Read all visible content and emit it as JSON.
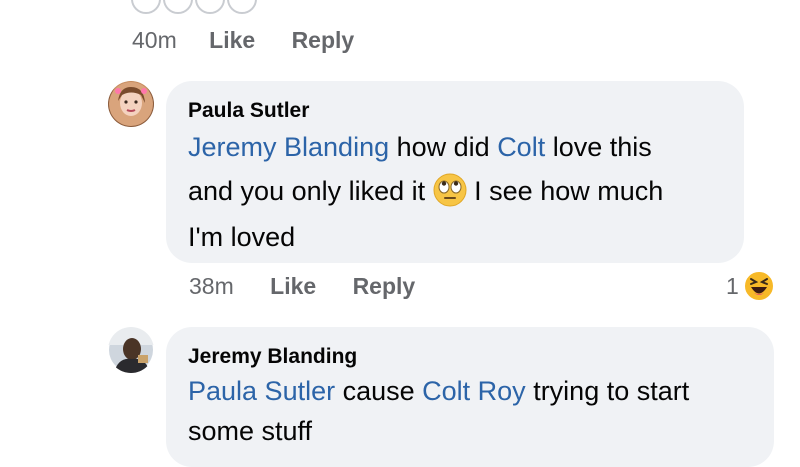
{
  "top_comment": {
    "time": "40m",
    "like_label": "Like",
    "reply_label": "Reply"
  },
  "comment1": {
    "author": "Paula Sutler",
    "mention1": "Jeremy Blanding",
    "text1": " how did ",
    "mention2": "Colt",
    "text2": " love this",
    "line2_before": "and you only liked it ",
    "emoji": "rolling-eyes-emoji",
    "line2_after": " I see how much",
    "line3": "I'm loved",
    "time": "38m",
    "like_label": "Like",
    "reply_label": "Reply",
    "reaction_count": "1",
    "reaction_icon": "haha-reaction-icon"
  },
  "comment2": {
    "author": "Jeremy Blanding",
    "mention1": "Paula Sutler",
    "text1": " cause ",
    "mention2": "Colt Roy",
    "text2": " trying to start",
    "line2": "some stuff"
  },
  "colors": {
    "mention": "#2c64a8",
    "bubble": "#f0f2f5",
    "meta": "#65676b",
    "haha_yellow": "#f7b928"
  }
}
